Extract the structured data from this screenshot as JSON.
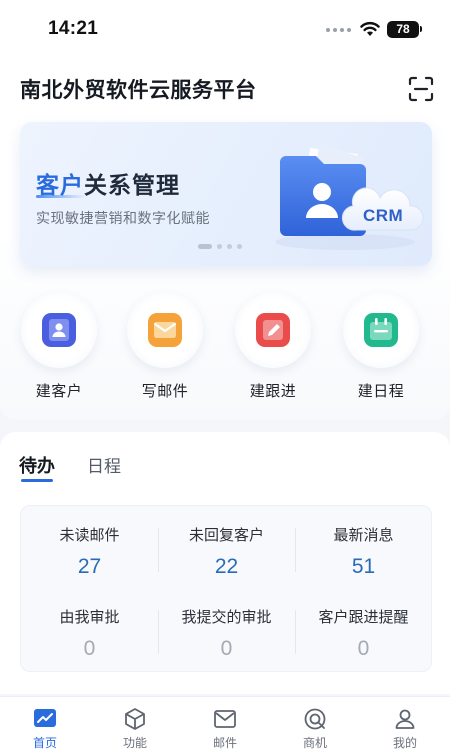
{
  "status_bar": {
    "time": "14:21",
    "battery": "78"
  },
  "header": {
    "title": "南北外贸软件云服务平台",
    "scan_icon": "scan-icon"
  },
  "banner": {
    "title_highlight": "客户",
    "title_rest": "关系管理",
    "subtitle": "实现敏捷营销和数字化赋能",
    "badge": "CRM",
    "slide_count": 4,
    "active_slide": 1
  },
  "quick_actions": [
    {
      "label": "建客户",
      "icon": "user-card-icon",
      "color": "#4a5fe0"
    },
    {
      "label": "写邮件",
      "icon": "mail-icon",
      "color": "#f5a23a"
    },
    {
      "label": "建跟进",
      "icon": "edit-icon",
      "color": "#ea4b4b"
    },
    {
      "label": "建日程",
      "icon": "calendar-icon",
      "color": "#23b98f"
    }
  ],
  "todo": {
    "tabs": [
      "待办",
      "日程"
    ],
    "active_tab": "待办",
    "stats": [
      {
        "label": "未读邮件",
        "value": "27"
      },
      {
        "label": "未回复客户",
        "value": "22"
      },
      {
        "label": "最新消息",
        "value": "51"
      },
      {
        "label": "由我审批",
        "value": "0"
      },
      {
        "label": "我提交的审批",
        "value": "0"
      },
      {
        "label": "客户跟进提醒",
        "value": "0"
      }
    ]
  },
  "bottom_nav": [
    {
      "label": "首页",
      "icon": "chart-icon",
      "active": true
    },
    {
      "label": "功能",
      "icon": "cube-icon",
      "active": false
    },
    {
      "label": "邮件",
      "icon": "mail-icon",
      "active": false
    },
    {
      "label": "商机",
      "icon": "target-icon",
      "active": false
    },
    {
      "label": "我的",
      "icon": "person-icon",
      "active": false
    }
  ],
  "colors": {
    "accent": "#2a6bde",
    "value_blue": "#2a6bb8",
    "value_grey": "#a4aab3"
  }
}
